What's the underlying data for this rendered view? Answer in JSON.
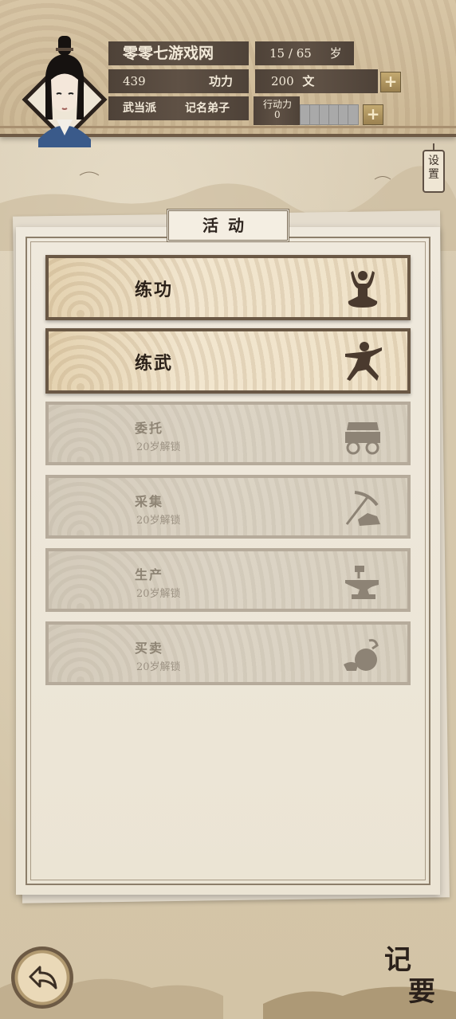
{
  "header": {
    "name": "零零七游戏网",
    "age_current": "15",
    "age_max": "65",
    "age_unit": "岁",
    "power_value": "439",
    "power_label": "功力",
    "money_value": "200",
    "money_unit": "文",
    "sect": "武当派",
    "rank": "记名弟子",
    "action_label": "行动力",
    "action_value": "0",
    "action_slots_total": 6,
    "action_slots_filled": 0
  },
  "settings": {
    "label_1": "设",
    "label_2": "置"
  },
  "panel": {
    "title": "活动"
  },
  "activities": [
    {
      "label": "练功",
      "sub": "",
      "locked": false,
      "icon": "meditation-icon"
    },
    {
      "label": "练武",
      "sub": "",
      "locked": false,
      "icon": "martial-stance-icon"
    },
    {
      "label": "委托",
      "sub": "20岁解锁",
      "locked": true,
      "icon": "cart-icon"
    },
    {
      "label": "采集",
      "sub": "20岁解锁",
      "locked": true,
      "icon": "pickaxe-icon"
    },
    {
      "label": "生产",
      "sub": "20岁解锁",
      "locked": true,
      "icon": "anvil-icon"
    },
    {
      "label": "买卖",
      "sub": "20岁解锁",
      "locked": true,
      "icon": "money-bag-icon"
    }
  ],
  "footer": {
    "notes_char_1": "记",
    "notes_char_2": "要"
  },
  "colors": {
    "dark_bar": "#4e4238",
    "frame": "#6a5845",
    "paper": "#efe9dd",
    "locked": "#d8d0c0"
  }
}
